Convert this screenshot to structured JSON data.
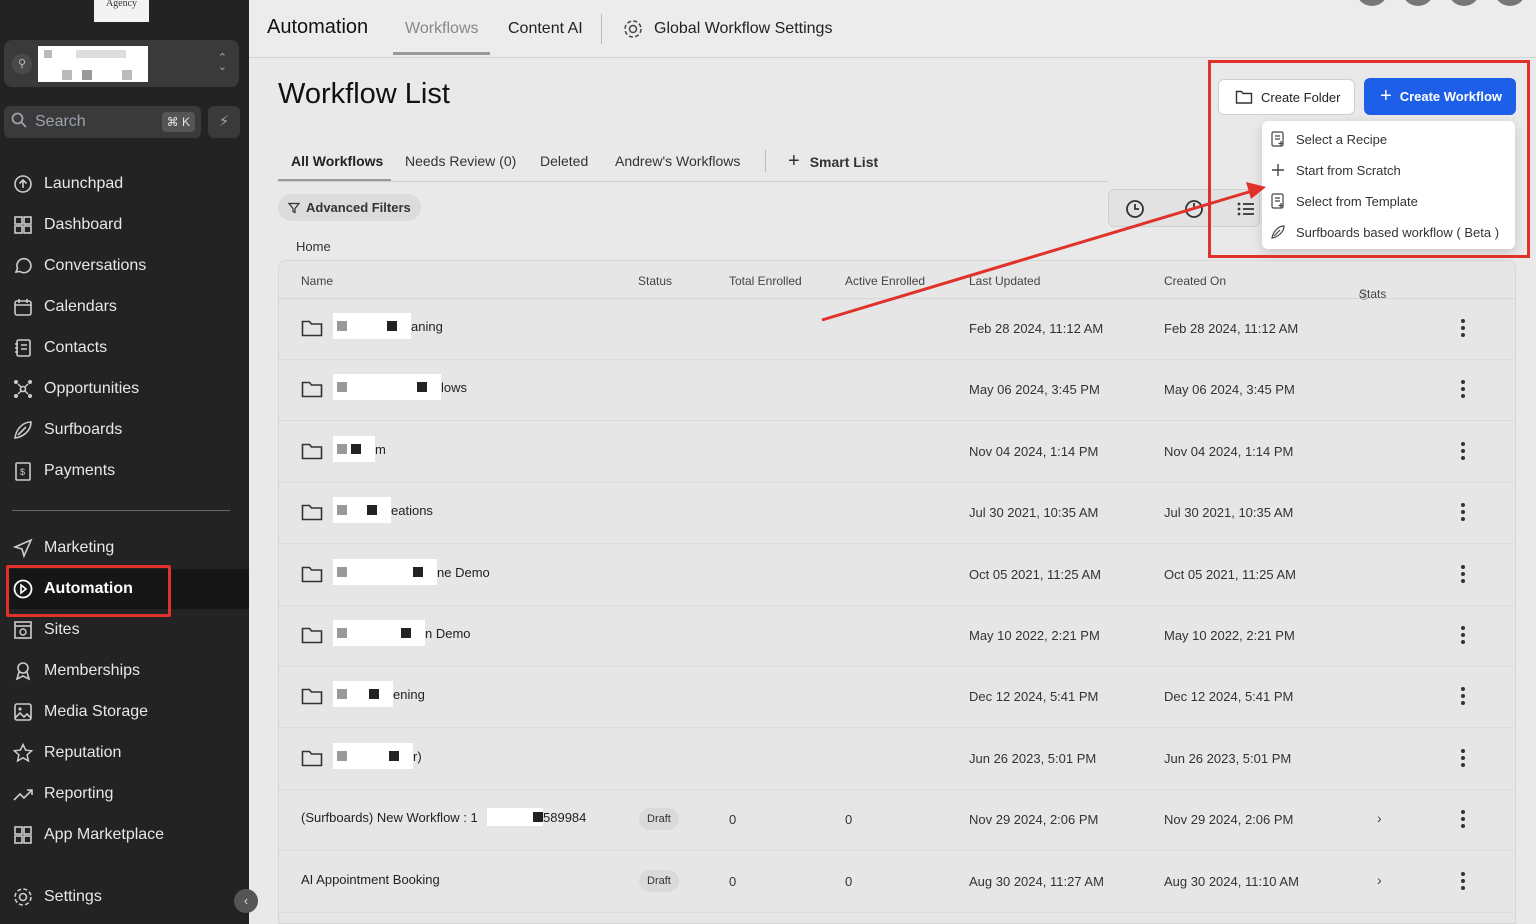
{
  "sidebar": {
    "logo_text": "Agency",
    "search_placeholder": "Search",
    "search_shortcut": "⌘ K",
    "items": [
      {
        "label": "Launchpad",
        "icon": "launchpad-icon"
      },
      {
        "label": "Dashboard",
        "icon": "dashboard-icon"
      },
      {
        "label": "Conversations",
        "icon": "chat-icon"
      },
      {
        "label": "Calendars",
        "icon": "calendar-icon"
      },
      {
        "label": "Contacts",
        "icon": "contacts-icon"
      },
      {
        "label": "Opportunities",
        "icon": "opportunities-icon"
      },
      {
        "label": "Surfboards",
        "icon": "surfboard-icon"
      },
      {
        "label": "Payments",
        "icon": "payments-icon"
      }
    ],
    "items2": [
      {
        "label": "Marketing",
        "icon": "send-icon"
      },
      {
        "label": "Automation",
        "icon": "automation-icon",
        "active": true
      },
      {
        "label": "Sites",
        "icon": "sites-icon"
      },
      {
        "label": "Memberships",
        "icon": "membership-icon"
      },
      {
        "label": "Media Storage",
        "icon": "image-icon"
      },
      {
        "label": "Reputation",
        "icon": "star-icon"
      },
      {
        "label": "Reporting",
        "icon": "trend-icon"
      },
      {
        "label": "App Marketplace",
        "icon": "grid-icon"
      }
    ],
    "settings_label": "Settings"
  },
  "topbar": {
    "title": "Automation",
    "tabs": [
      "Workflows",
      "Content AI"
    ],
    "global_settings": "Global Workflow Settings"
  },
  "page": {
    "title": "Workflow List",
    "tabs": [
      "All Workflows",
      "Needs Review (0)",
      "Deleted",
      "Andrew's Workflows"
    ],
    "smart_list": "Smart List",
    "advanced_filters": "Advanced Filters",
    "breadcrumb": "Home",
    "create_folder": "Create Folder",
    "create_workflow": "Create Workflow",
    "dropdown": [
      "Select a Recipe",
      "Start from Scratch",
      "Select from Template",
      "Surfboards based workflow ( Beta )"
    ]
  },
  "table": {
    "columns": [
      "Name",
      "Status",
      "Total Enrolled",
      "Active Enrolled",
      "Last Updated",
      "Created On",
      "Stats"
    ],
    "folders": [
      {
        "name": "aning",
        "updated": "Feb 28 2024, 11:12 AM",
        "created": "Feb 28 2024, 11:12 AM"
      },
      {
        "name": "lows",
        "updated": "May 06 2024, 3:45 PM",
        "created": "May 06 2024, 3:45 PM"
      },
      {
        "name": "m",
        "updated": "Nov 04 2024, 1:14 PM",
        "created": "Nov 04 2024, 1:14 PM"
      },
      {
        "name": "eations",
        "updated": "Jul 30 2021, 10:35 AM",
        "created": "Jul 30 2021, 10:35 AM"
      },
      {
        "name": "ne Demo",
        "updated": "Oct 05 2021, 11:25 AM",
        "created": "Oct 05 2021, 11:25 AM"
      },
      {
        "name": "n Demo",
        "updated": "May 10 2022, 2:21 PM",
        "created": "May 10 2022, 2:21 PM"
      },
      {
        "name": "ening",
        "updated": "Dec 12 2024, 5:41 PM",
        "created": "Dec 12 2024, 5:41 PM"
      },
      {
        "name": "r)",
        "updated": "Jun 26 2023, 5:01 PM",
        "created": "Jun 26 2023, 5:01 PM"
      }
    ],
    "workflows": [
      {
        "name": "(Surfboards) New Workflow : 1",
        "name_tail": "589984",
        "status": "Draft",
        "total": "0",
        "active": "0",
        "updated": "Nov 29 2024, 2:06 PM",
        "created": "Nov 29 2024, 2:06 PM"
      },
      {
        "name": "AI Appointment Booking",
        "name_tail": "",
        "status": "Draft",
        "total": "0",
        "active": "0",
        "updated": "Aug 30 2024, 11:27 AM",
        "created": "Aug 30 2024, 11:10 AM"
      }
    ]
  }
}
